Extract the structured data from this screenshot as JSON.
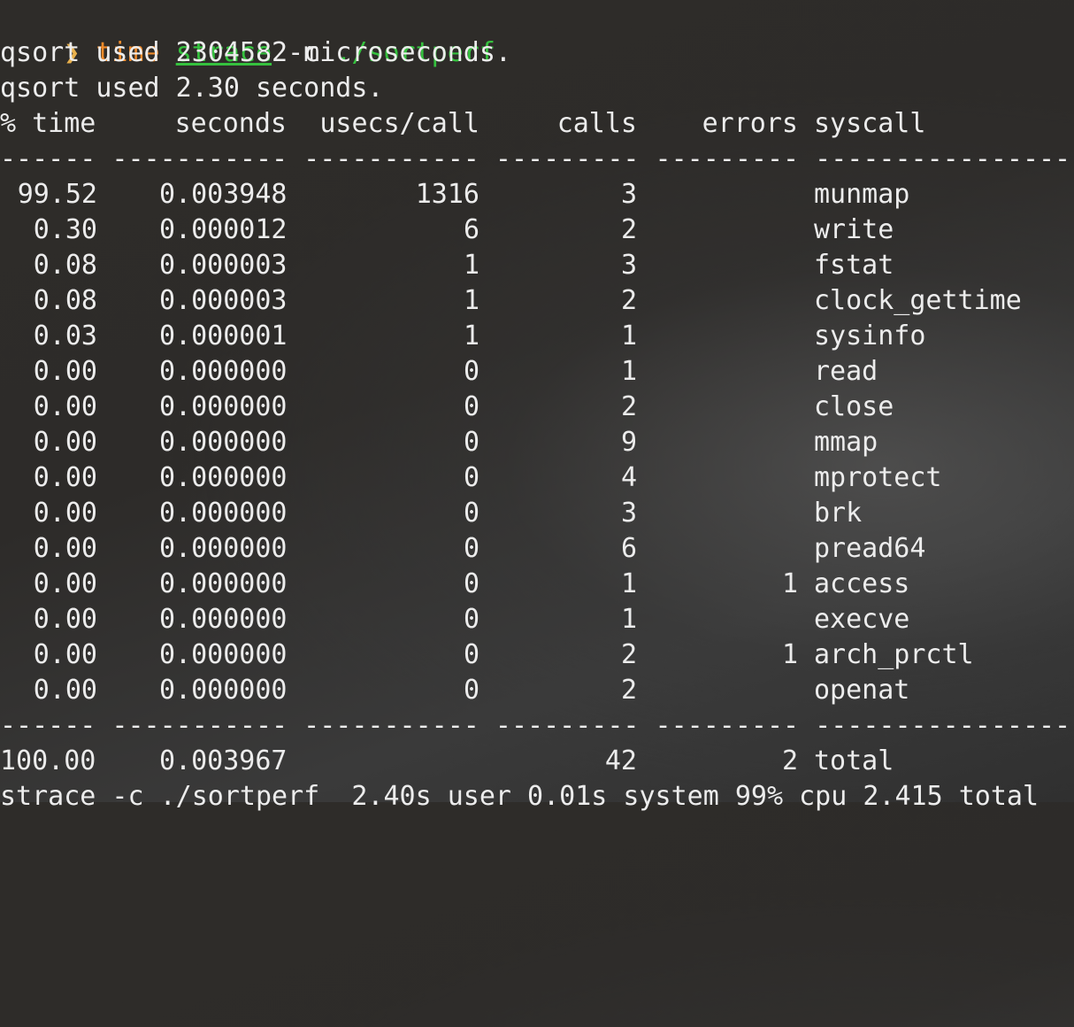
{
  "prompt": {
    "arrow": "❯",
    "time": "time",
    "strace": "strace",
    "flag": " -c",
    "path": " ./sortperf"
  },
  "output": {
    "line1": "qsort used 2304582 microseconds.",
    "line2": "qsort used 2.30 seconds."
  },
  "table": {
    "headers": {
      "time": "% time",
      "seconds": "seconds",
      "usecs": "usecs/call",
      "calls": "calls",
      "errors": "errors",
      "syscall": "syscall"
    },
    "rule": "------ ----------- ----------- --------- --------- ----------------",
    "rows": [
      {
        "time": "99.52",
        "seconds": "0.003948",
        "usecs": "1316",
        "calls": "3",
        "errors": "",
        "syscall": "munmap"
      },
      {
        "time": "0.30",
        "seconds": "0.000012",
        "usecs": "6",
        "calls": "2",
        "errors": "",
        "syscall": "write"
      },
      {
        "time": "0.08",
        "seconds": "0.000003",
        "usecs": "1",
        "calls": "3",
        "errors": "",
        "syscall": "fstat"
      },
      {
        "time": "0.08",
        "seconds": "0.000003",
        "usecs": "1",
        "calls": "2",
        "errors": "",
        "syscall": "clock_gettime"
      },
      {
        "time": "0.03",
        "seconds": "0.000001",
        "usecs": "1",
        "calls": "1",
        "errors": "",
        "syscall": "sysinfo"
      },
      {
        "time": "0.00",
        "seconds": "0.000000",
        "usecs": "0",
        "calls": "1",
        "errors": "",
        "syscall": "read"
      },
      {
        "time": "0.00",
        "seconds": "0.000000",
        "usecs": "0",
        "calls": "2",
        "errors": "",
        "syscall": "close"
      },
      {
        "time": "0.00",
        "seconds": "0.000000",
        "usecs": "0",
        "calls": "9",
        "errors": "",
        "syscall": "mmap"
      },
      {
        "time": "0.00",
        "seconds": "0.000000",
        "usecs": "0",
        "calls": "4",
        "errors": "",
        "syscall": "mprotect"
      },
      {
        "time": "0.00",
        "seconds": "0.000000",
        "usecs": "0",
        "calls": "3",
        "errors": "",
        "syscall": "brk"
      },
      {
        "time": "0.00",
        "seconds": "0.000000",
        "usecs": "0",
        "calls": "6",
        "errors": "",
        "syscall": "pread64"
      },
      {
        "time": "0.00",
        "seconds": "0.000000",
        "usecs": "0",
        "calls": "1",
        "errors": "1",
        "syscall": "access"
      },
      {
        "time": "0.00",
        "seconds": "0.000000",
        "usecs": "0",
        "calls": "1",
        "errors": "",
        "syscall": "execve"
      },
      {
        "time": "0.00",
        "seconds": "0.000000",
        "usecs": "0",
        "calls": "2",
        "errors": "1",
        "syscall": "arch_prctl"
      },
      {
        "time": "0.00",
        "seconds": "0.000000",
        "usecs": "0",
        "calls": "2",
        "errors": "",
        "syscall": "openat"
      }
    ],
    "total": {
      "time": "100.00",
      "seconds": "0.003967",
      "usecs": "",
      "calls": "42",
      "errors": "2",
      "syscall": "total"
    }
  },
  "summary": "strace -c ./sortperf  2.40s user 0.01s system 99% cpu 2.415 total",
  "colors": {
    "background": "#2b2a28",
    "foreground": "#ececec",
    "prompt_arrow": "#e8b04b",
    "command_time": "#f08b2a",
    "command_green": "#35c13e"
  }
}
